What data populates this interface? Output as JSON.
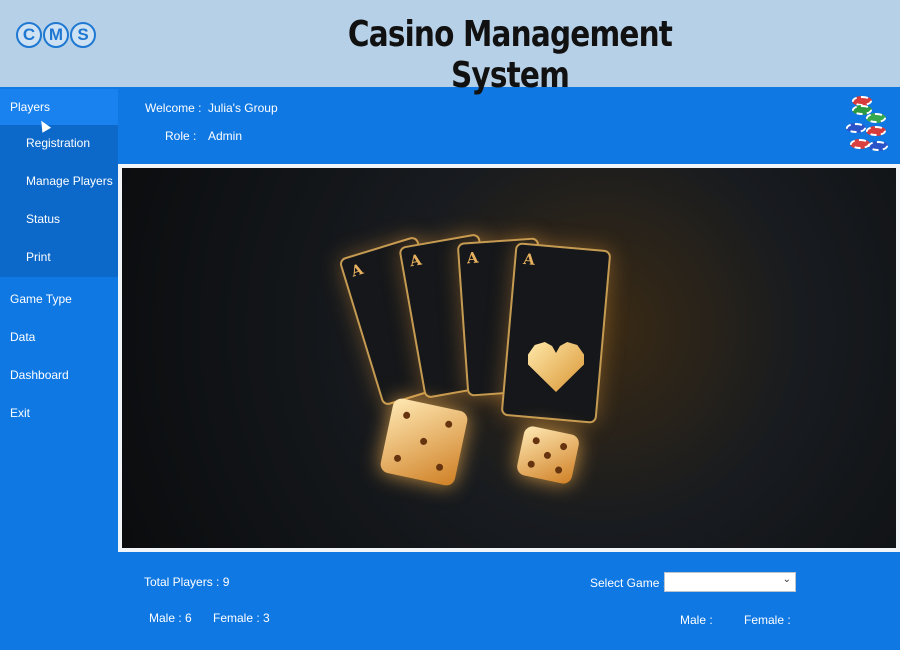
{
  "header": {
    "logo_letters": [
      "C",
      "M",
      "S"
    ],
    "title": "Casino Management System"
  },
  "sidebar": {
    "items": [
      {
        "label": "Players"
      },
      {
        "label": "Game Type"
      },
      {
        "label": "Data"
      },
      {
        "label": "Dashboard"
      },
      {
        "label": "Exit"
      }
    ],
    "submenu": [
      {
        "label": "Registration"
      },
      {
        "label": "Manage Players"
      },
      {
        "label": "Status"
      },
      {
        "label": "Print"
      }
    ]
  },
  "user": {
    "welcome_label": "Welcome :",
    "welcome_value": "Julia's Group",
    "role_label": "Role :",
    "role_value": "Admin"
  },
  "stats": {
    "total_players": "Total Players : 9",
    "male": "Male : 6",
    "female": "Female : 3",
    "select_game_label": "Select Game :",
    "select_game_value": "",
    "game_male_label": "Male :",
    "game_female_label": "Female :"
  },
  "icons": {
    "logo": "cms-logo-icon",
    "chips": "casino-chips-icon",
    "dropdown": "chevron-down-icon",
    "cursor": "mouse-pointer-icon"
  },
  "colors": {
    "header_bg": "#b6d0e8",
    "primary_blue": "#0f78e3",
    "submenu_blue": "#0d69c9",
    "accent_gold": "#e7b15f"
  }
}
